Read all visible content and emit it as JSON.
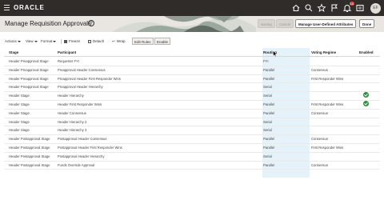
{
  "topbar": {
    "logo": "ORACLE",
    "icons": [
      "menu-icon",
      "home-icon",
      "search-icon",
      "star-icon",
      "flag-icon",
      "notifications-icon",
      "apps-icon"
    ],
    "notification_count": "10",
    "avatar_initials": "EF",
    "bg_color": "#2f2c2a"
  },
  "header": {
    "title": "Manage Requisition Approvals",
    "buttons": {
      "saving": "Saving",
      "cancel": "Cancel",
      "manage_attrs": "Manage User-Defined Attributes",
      "done": "Done"
    }
  },
  "toolbar": {
    "actions": "Actions",
    "view": "View",
    "format": "Format",
    "freeze": "Freeze",
    "detach": "Detach",
    "wrap": "Wrap",
    "edit_rules": "Edit Rules",
    "enable": "Enable"
  },
  "table": {
    "columns": [
      "Stage",
      "Participant",
      "Routing",
      "Voting Regime",
      "Enabled"
    ],
    "rows": [
      {
        "stage": "Header Preapproval Stage",
        "participant": "Requester FYI",
        "routing": "FYI",
        "voting": "",
        "enabled": false
      },
      {
        "stage": "Header Preapproval Stage",
        "participant": "Preapproval Header Consensus",
        "routing": "Parallel",
        "voting": "Consensus",
        "enabled": false
      },
      {
        "stage": "Header Preapproval Stage",
        "participant": "Preapproval Header First Responder Wins",
        "routing": "Parallel",
        "voting": "First Responder Wins",
        "enabled": false
      },
      {
        "stage": "Header Preapproval Stage",
        "participant": "Preapproval Header Hierarchy",
        "routing": "Serial",
        "voting": "",
        "enabled": false
      },
      {
        "stage": "Header Stage",
        "participant": "Header Hierarchy",
        "routing": "Serial",
        "voting": "",
        "enabled": true
      },
      {
        "stage": "Header Stage",
        "participant": "Header First Responder Wins",
        "routing": "Parallel",
        "voting": "First Responder Wins",
        "enabled": true
      },
      {
        "stage": "Header Stage",
        "participant": "Header Consensus",
        "routing": "Parallel",
        "voting": "Consensus",
        "enabled": false
      },
      {
        "stage": "Header Stage",
        "participant": "Header Hierarchy 2",
        "routing": "Serial",
        "voting": "",
        "enabled": false
      },
      {
        "stage": "Header Stage",
        "participant": "Header Hierarchy 3",
        "routing": "Serial",
        "voting": "",
        "enabled": false
      },
      {
        "stage": "Header Postapproval Stage",
        "participant": "Postapproval Header Consensus",
        "routing": "Parallel",
        "voting": "Consensus",
        "enabled": false
      },
      {
        "stage": "Header Postapproval Stage",
        "participant": "Postapproval Header First Responder Wins",
        "routing": "Parallel",
        "voting": "First Responder Wins",
        "enabled": false
      },
      {
        "stage": "Header Postapproval Stage",
        "participant": "Postapproval Header Hierarchy",
        "routing": "Serial",
        "voting": "",
        "enabled": false
      },
      {
        "stage": "Header Postapproval Stage",
        "participant": "Funds Override Approval",
        "routing": "Parallel",
        "voting": "Consensus",
        "enabled": false
      }
    ]
  },
  "colors": {
    "accent_check": "#2d8a3e",
    "routing_highlight": "#e6f2fa",
    "badge": "#c74634"
  }
}
